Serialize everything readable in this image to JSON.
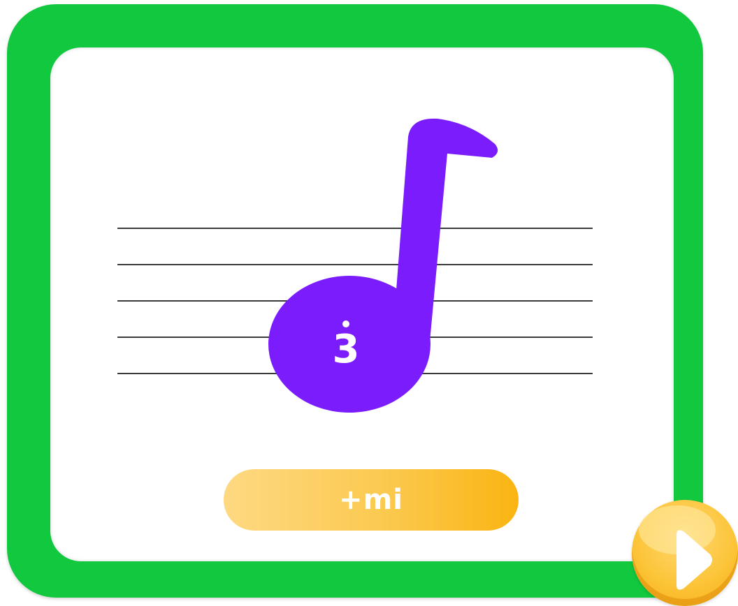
{
  "note": {
    "digit": "3",
    "color": "#7b1cfc"
  },
  "answer_button": {
    "label": "+mi"
  },
  "colors": {
    "frame": "#12c83f",
    "staff_line": "#3a3a3a",
    "button_gradient_start": "#fed982",
    "button_gradient_end": "#fbb412"
  },
  "icons": {
    "play": "play-triangle-icon"
  }
}
